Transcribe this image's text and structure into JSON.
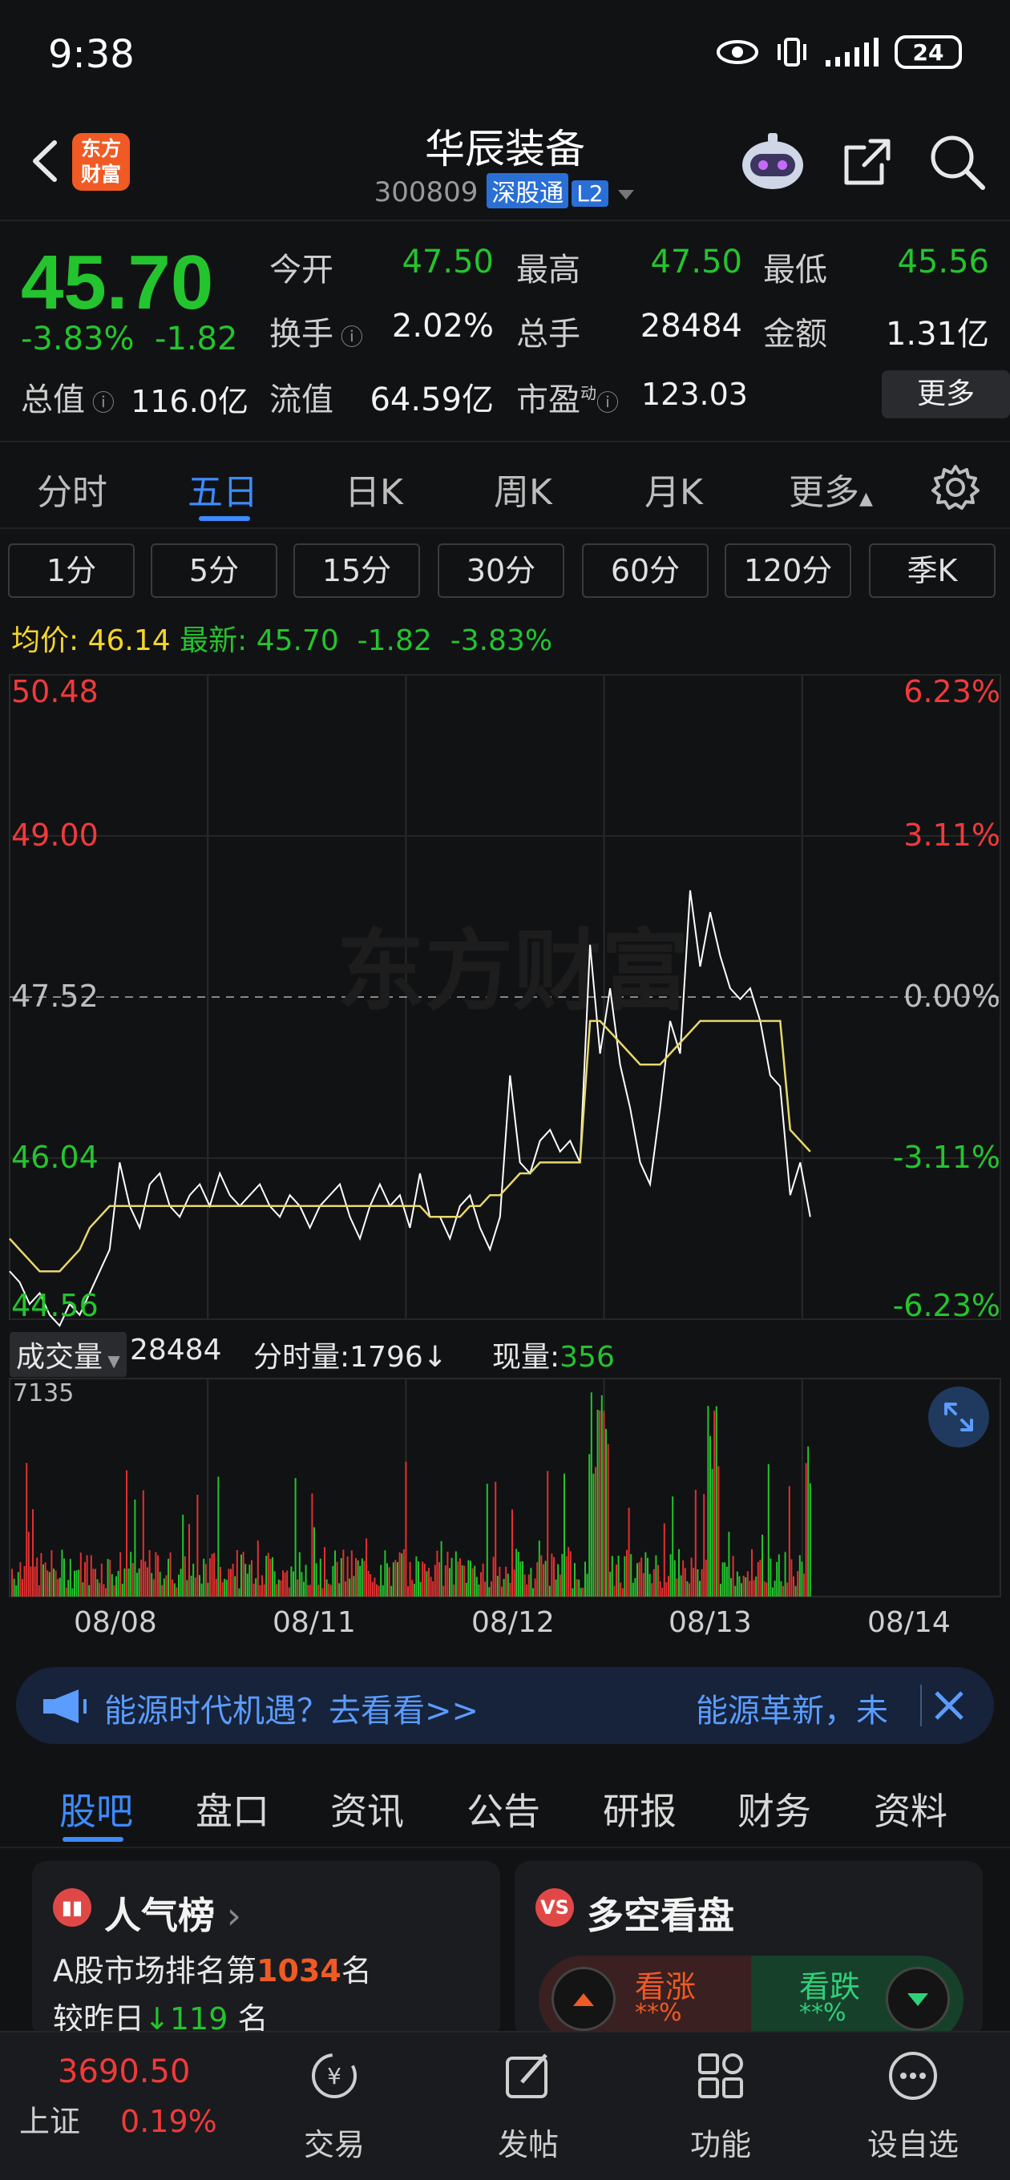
{
  "status_bar": {
    "time": "9:38",
    "battery": "24"
  },
  "header": {
    "logo_text_line1": "东方",
    "logo_text_line2": "财富",
    "stock_name": "华辰装备",
    "stock_code": "300809",
    "connect_tag": "深股通",
    "level_tag": "L2"
  },
  "quote": {
    "price": "45.70",
    "change_pct": "-3.83%",
    "change_abs": "-1.82",
    "open_label": "今开",
    "open": "47.50",
    "high_label": "最高",
    "high": "47.50",
    "low_label": "最低",
    "low": "45.56",
    "turnover_label": "换手",
    "turnover": "2.02%",
    "volume_label": "总手",
    "volume": "28484",
    "amount_label": "金额",
    "amount": "1.31亿",
    "total_mv_label": "总值",
    "total_mv": "116.0亿",
    "float_mv_label": "流值",
    "float_mv": "64.59亿",
    "pe_label": "市盈",
    "pe_sup": "动",
    "pe": "123.03",
    "more_button": "更多"
  },
  "period_tabs": [
    {
      "label": "分时"
    },
    {
      "label": "五日"
    },
    {
      "label": "日K"
    },
    {
      "label": "周K"
    },
    {
      "label": "月K"
    },
    {
      "label": "更多"
    }
  ],
  "active_period": "五日",
  "intervals": [
    "1分",
    "5分",
    "15分",
    "30分",
    "60分",
    "120分",
    "季K"
  ],
  "avg_row": {
    "avg_label": "均价:",
    "avg_value": "46.14",
    "latest_label": "最新:",
    "latest_value": "45.70",
    "latest_change": "-1.82",
    "latest_pct": "-3.83%"
  },
  "chart_data": {
    "type": "line",
    "title": "",
    "x_days": [
      "08/08",
      "08/11",
      "08/12",
      "08/13",
      "08/14"
    ],
    "y_ticks_left": [
      "50.48",
      "49.00",
      "47.52",
      "46.04",
      "44.56"
    ],
    "y_ticks_right": [
      "6.23%",
      "3.11%",
      "0.00%",
      "-3.11%",
      "-6.23%"
    ],
    "ylim": [
      44.56,
      50.48
    ],
    "reference_price": 47.52,
    "series": [
      {
        "name": "最新",
        "color": "#ffffff",
        "values": [
          45.0,
          44.9,
          44.7,
          44.8,
          44.6,
          44.5,
          44.7,
          44.6,
          44.8,
          45.0,
          45.2,
          46.0,
          45.6,
          45.4,
          45.8,
          45.9,
          45.6,
          45.5,
          45.7,
          45.8,
          45.6,
          45.9,
          45.7,
          45.6,
          45.7,
          45.8,
          45.6,
          45.5,
          45.7,
          45.6,
          45.4,
          45.6,
          45.7,
          45.8,
          45.5,
          45.3,
          45.6,
          45.8,
          45.6,
          45.7,
          45.4,
          45.9,
          45.5,
          45.5,
          45.3,
          45.6,
          45.7,
          45.4,
          45.2,
          45.5,
          46.8,
          46.0,
          45.9,
          46.2,
          46.3,
          46.1,
          46.2,
          46.0,
          48.0,
          47.0,
          47.6,
          46.9,
          46.5,
          46.0,
          45.8,
          46.5,
          47.3,
          47.0,
          48.5,
          47.8,
          48.3,
          47.9,
          47.6,
          47.5,
          47.6,
          47.3,
          46.8,
          46.7,
          45.7,
          46.0,
          45.5
        ],
        "color_note": "white price line"
      },
      {
        "name": "均价",
        "color": "#e8d86a",
        "values": [
          45.3,
          45.2,
          45.1,
          45.0,
          45.0,
          45.0,
          45.1,
          45.2,
          45.4,
          45.5,
          45.6,
          45.6,
          45.6,
          45.6,
          45.6,
          45.6,
          45.6,
          45.6,
          45.6,
          45.6,
          45.6,
          45.6,
          45.6,
          45.6,
          45.6,
          45.6,
          45.6,
          45.6,
          45.6,
          45.6,
          45.6,
          45.6,
          45.6,
          45.6,
          45.6,
          45.6,
          45.6,
          45.6,
          45.6,
          45.6,
          45.6,
          45.6,
          45.5,
          45.5,
          45.5,
          45.5,
          45.6,
          45.6,
          45.7,
          45.7,
          45.8,
          45.9,
          45.9,
          46.0,
          46.0,
          46.0,
          46.0,
          46.0,
          47.3,
          47.3,
          47.2,
          47.1,
          47.0,
          46.9,
          46.9,
          46.9,
          47.0,
          47.1,
          47.2,
          47.3,
          47.3,
          47.3,
          47.3,
          47.3,
          47.3,
          47.3,
          47.3,
          47.3,
          46.3,
          46.2,
          46.1
        ]
      }
    ],
    "volume": {
      "label": "成交量",
      "total": "28484",
      "minute_label": "分时量:",
      "minute_value": "1796↓",
      "current_label": "现量:",
      "current_value": "356",
      "max_tick": "7135"
    },
    "watermark": "东方财富"
  },
  "banner": {
    "text_left": "能源时代机遇？去看看>>",
    "text_right": "能源革新，未"
  },
  "info_tabs": [
    "股吧",
    "盘口",
    "资讯",
    "公告",
    "研报",
    "财务",
    "资料"
  ],
  "active_info_tab": "股吧",
  "card_popularity": {
    "title": "人气榜",
    "rank_prefix": "A股市场排名第",
    "rank_value": "1034",
    "rank_suffix": "名",
    "compare_prefix": "较昨日",
    "compare_value": "119",
    "compare_suffix": "名"
  },
  "card_longshort": {
    "title": "多空看盘",
    "bull_label": "看涨",
    "bull_pct": "**%",
    "bear_label": "看跌",
    "bear_pct": "**%"
  },
  "bottom_nav": {
    "index_value": "3690.50",
    "index_name": "上证",
    "index_pct": "0.19%",
    "items": [
      "交易",
      "发帖",
      "功能",
      "设自选"
    ]
  },
  "colors": {
    "up": "#f03a3a",
    "down": "#24c42e",
    "accent": "#3d8bff",
    "avg_line": "#e8d86a",
    "brand": "#f05a24"
  }
}
